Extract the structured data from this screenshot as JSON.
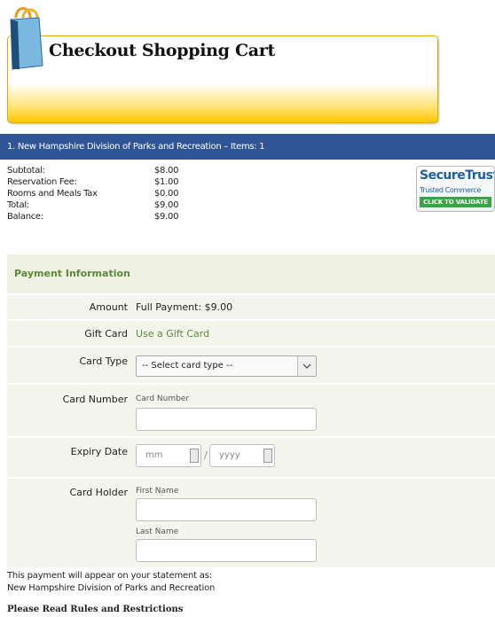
{
  "header": {
    "title": "Checkout Shopping Cart"
  },
  "cart": {
    "bar_text": "1. New Hampshire Division of Parks and Recreation – Items: 1",
    "summary": [
      {
        "label": "Subtotal:",
        "value": "$8.00"
      },
      {
        "label": "Reservation Fee:",
        "value": "$1.00"
      },
      {
        "label": "Rooms and Meals Tax",
        "value": "$0.00"
      },
      {
        "label": "Total:",
        "value": "$9.00"
      },
      {
        "label": "Balance:",
        "value": "$9.00"
      }
    ]
  },
  "badge": {
    "line1": "SecureTrust",
    "line2": "Trusted Commerce",
    "cta": "CLICK TO VALIDATE"
  },
  "payment": {
    "header": "Payment Information",
    "amount_label": "Amount",
    "amount_value": "Full Payment: $9.00",
    "gift_label": "Gift Card",
    "gift_link": "Use a Gift Card",
    "card_type_label": "Card Type",
    "card_type_value": "-- Select card type --",
    "card_number_label": "Card Number",
    "card_number_sublabel": "Card Number",
    "expiry_label": "Expiry Date",
    "expiry_month_placeholder": "mm",
    "expiry_sep": "/",
    "expiry_year_placeholder": "yyyy",
    "holder_label": "Card Holder",
    "first_name_label": "First Name",
    "last_name_label": "Last Name"
  },
  "footer": {
    "statement_line1": "This payment will appear on your statement as:",
    "statement_line2": "New Hampshire Division of Parks and Recreation",
    "rules_link": "Please Read Rules and Restrictions"
  },
  "colors": {
    "bar": "#2f5597",
    "accent_green": "#5a8a3a",
    "header_gold": "#ffc800"
  }
}
